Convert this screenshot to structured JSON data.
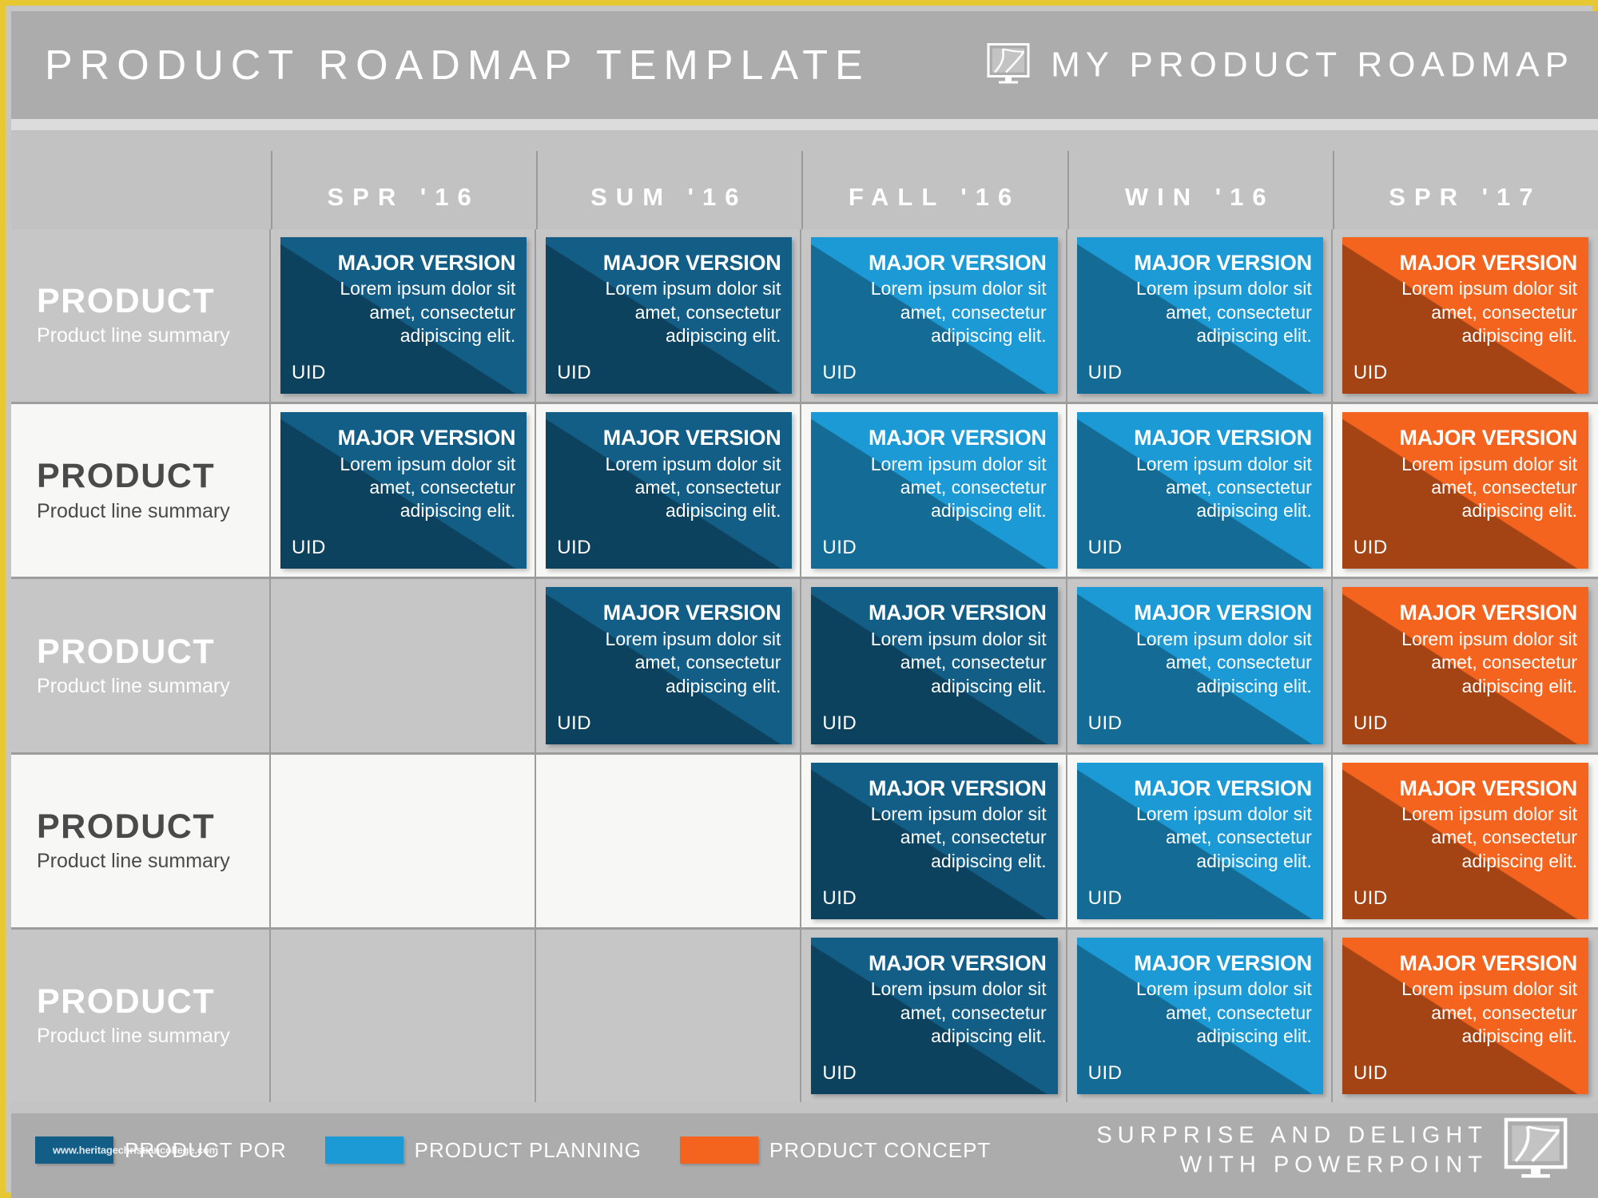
{
  "header": {
    "title": "PRODUCT ROADMAP TEMPLATE",
    "brand": "MY PRODUCT  ROADMAP",
    "logo_icon": "monitor-road-icon"
  },
  "timeline": {
    "columns": [
      "SPR '16",
      "SUM '16",
      "FALL '16",
      "WIN '16",
      "SPR '17"
    ]
  },
  "card_defaults": {
    "title": "MAJOR VERSION",
    "description": "Lorem ipsum dolor sit amet, consectetur adipiscing elit.",
    "uid": "UID"
  },
  "rows": [
    {
      "title": "PRODUCT",
      "subtitle": "Product line summary",
      "shade": "dark",
      "cards": [
        "dark",
        "dark",
        "light",
        "light",
        "orange"
      ]
    },
    {
      "title": "PRODUCT",
      "subtitle": "Product line summary",
      "shade": "light",
      "cards": [
        "dark",
        "dark",
        "light",
        "light",
        "orange"
      ]
    },
    {
      "title": "PRODUCT",
      "subtitle": "Product line summary",
      "shade": "dark",
      "cards": [
        "",
        "dark",
        "dark",
        "light",
        "orange"
      ]
    },
    {
      "title": "PRODUCT",
      "subtitle": "Product line summary",
      "shade": "light",
      "cards": [
        "",
        "",
        "dark",
        "light",
        "orange"
      ]
    },
    {
      "title": "PRODUCT",
      "subtitle": "Product line summary",
      "shade": "dark",
      "cards": [
        "",
        "",
        "dark",
        "light",
        "orange"
      ]
    }
  ],
  "footer": {
    "legend": [
      {
        "label": "PRODUCT POR",
        "color": "#135E86",
        "swatch_name": "legend-swatch-product-por"
      },
      {
        "label": "PRODUCT PLANNING",
        "color": "#1C9AD6",
        "swatch_name": "legend-swatch-product-planning"
      },
      {
        "label": "PRODUCT CONCEPT",
        "color": "#F4641E",
        "swatch_name": "legend-swatch-product-concept"
      }
    ],
    "watermark": "www.heritagechristiancollege.com",
    "tagline_line1": "SURPRISE AND DELIGHT",
    "tagline_line2": "WITH POWERPOINT",
    "logo_icon": "monitor-road-icon"
  },
  "colors": {
    "border": "#E8C832",
    "header_bg": "#ACACAC",
    "row_dark": "#C6C6C6",
    "row_light": "#F7F7F5",
    "card_dark_blue": "#135E86",
    "card_light_blue": "#1C9AD6",
    "card_orange": "#F4641E"
  }
}
